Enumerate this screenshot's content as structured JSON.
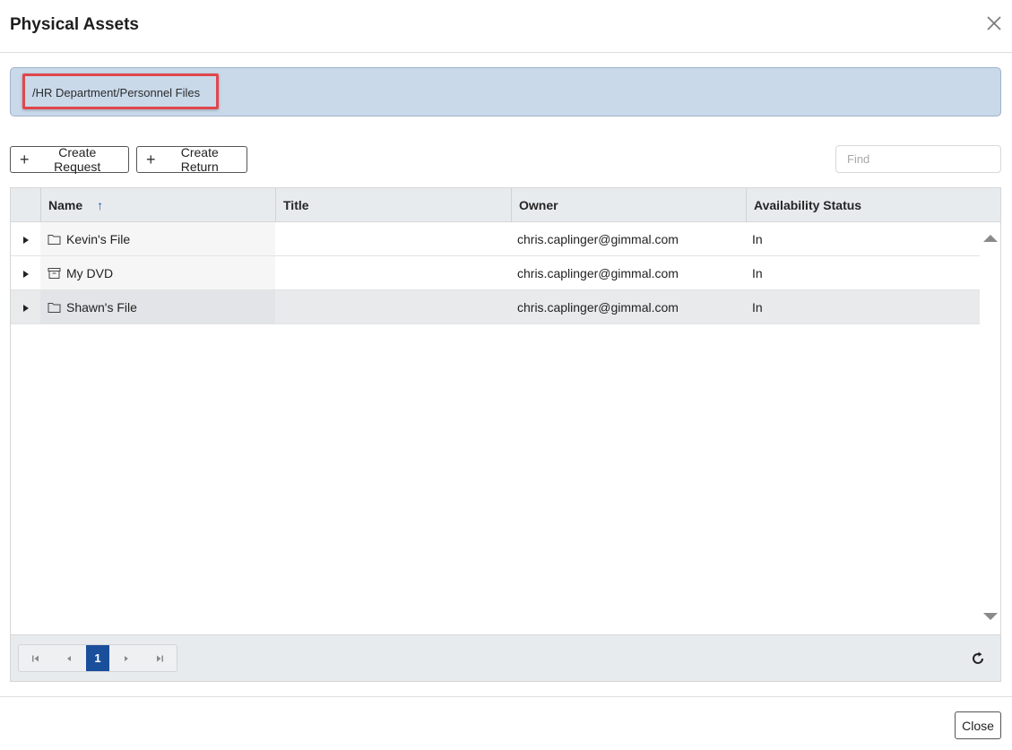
{
  "dialog": {
    "title": "Physical Assets"
  },
  "path": {
    "text": "/HR Department/Personnel Files"
  },
  "toolbar": {
    "create_request_label": "Create Request",
    "create_return_label": "Create Return",
    "find_placeholder": "Find"
  },
  "grid": {
    "columns": {
      "name": "Name",
      "title": "Title",
      "owner": "Owner",
      "status": "Availability Status"
    },
    "sort": {
      "column": "Name",
      "direction": "ascending",
      "icon": "arrow-up-icon"
    },
    "rows": [
      {
        "name": "Kevin's File",
        "icon": "folder-icon",
        "title": "",
        "owner": "chris.caplinger@gimmal.com",
        "status": "In",
        "selected": false
      },
      {
        "name": "My DVD",
        "icon": "archive-box-icon",
        "title": "",
        "owner": "chris.caplinger@gimmal.com",
        "status": "In",
        "selected": false
      },
      {
        "name": "Shawn's File",
        "icon": "folder-icon",
        "title": "",
        "owner": "chris.caplinger@gimmal.com",
        "status": "In",
        "selected": true
      }
    ]
  },
  "pager": {
    "current_page": "1"
  },
  "footer": {
    "close_label": "Close"
  },
  "colors": {
    "path_bar_bg": "#c9d9ea",
    "highlight_border": "#e0474c",
    "accent": "#1a4f9c"
  }
}
